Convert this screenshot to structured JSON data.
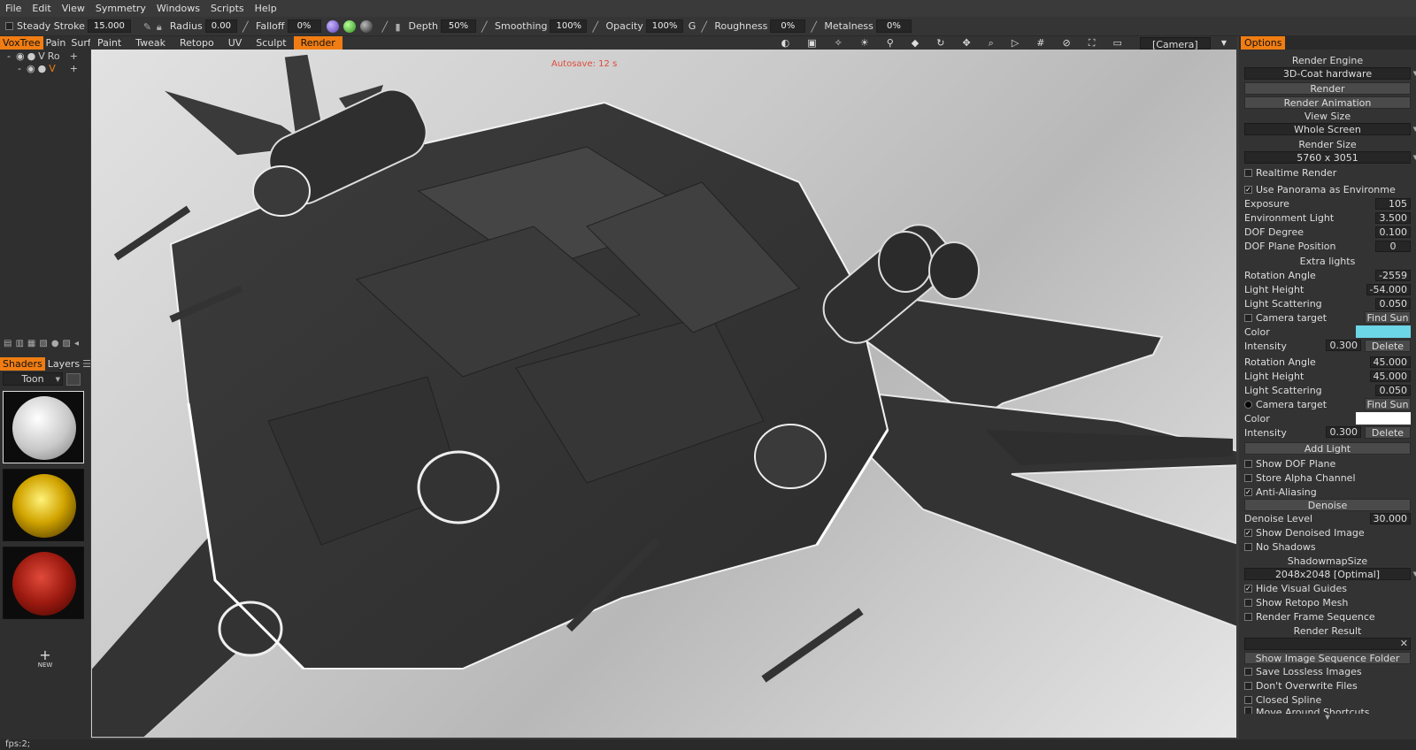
{
  "menu": [
    "File",
    "Edit",
    "View",
    "Symmetry",
    "Windows",
    "Scripts",
    "Help"
  ],
  "toolbar": {
    "steady_label": "Steady Stroke",
    "steady_value": "15.000",
    "radius_label": "Radius",
    "radius_value": "0.00",
    "falloff_label": "Falloff",
    "falloff_value": "0%",
    "depth_label": "Depth",
    "depth_value": "50%",
    "smoothing_label": "Smoothing",
    "smoothing_value": "100%",
    "opacity_label": "Opacity",
    "opacity_value": "100%",
    "g_label": "G",
    "roughness_label": "Roughness",
    "roughness_value": "0%",
    "metalness_label": "Metalness",
    "metalness_value": "0%",
    "camera_select": "[Camera]"
  },
  "left": {
    "tabs": [
      "VoxTree",
      "Pain",
      "Surf"
    ],
    "tree": [
      {
        "name": "V",
        "sub": "Ro"
      },
      {
        "name": "V",
        "sub": ""
      }
    ],
    "bottom_tabs": [
      "Shaders",
      "Layers"
    ],
    "shader_select": "Toon",
    "new_label": "NEW"
  },
  "mode_tabs": [
    "Paint",
    "Tweak",
    "Retopo",
    "UV",
    "Sculpt",
    "Render"
  ],
  "viewport": {
    "autosave": "Autosave:  12  s"
  },
  "options": {
    "title": "Options",
    "render_engine_label": "Render Engine",
    "render_engine": "3D-Coat hardware",
    "render_btn": "Render",
    "render_anim_btn": "Render Animation",
    "view_size_label": "View Size",
    "view_size": "Whole Screen",
    "render_size_label": "Render Size",
    "render_size": "5760  x  3051",
    "realtime": "Realtime  Render",
    "use_panorama": "Use  Panorama  as  Environme",
    "exposure_label": "Exposure",
    "exposure": "105",
    "env_light_label": "Environment  Light",
    "env_light": "3.500",
    "dof_degree_label": "DOF  Degree",
    "dof_degree": "0.100",
    "dof_plane_label": "DOF  Plane  Position",
    "dof_plane": "0",
    "extra_lights": "Extra  lights",
    "light1": {
      "rot_label": "Rotation  Angle",
      "rot": "-2559",
      "height_label": "Light  Height",
      "height": "-54.000",
      "scatter_label": "Light  Scattering",
      "scatter": "0.050",
      "camera_target": "Camera  target",
      "find_sun": "Find  Sun",
      "color_label": "Color",
      "color": "#6dd6e6",
      "intensity_label": "Intensity",
      "intensity": "0.300",
      "delete": "Delete"
    },
    "light2": {
      "rot_label": "Rotation  Angle",
      "rot": "45.000",
      "height_label": "Light  Height",
      "height": "45.000",
      "scatter_label": "Light  Scattering",
      "scatter": "0.050",
      "camera_target": "Camera  target",
      "find_sun": "Find  Sun",
      "color_label": "Color",
      "color": "#ffffff",
      "intensity_label": "Intensity",
      "intensity": "0.300",
      "delete": "Delete"
    },
    "add_light": "Add  Light",
    "show_dof": "Show  DOF  Plane",
    "store_alpha": "Store  Alpha  Channel",
    "anti_alias": "Anti-Aliasing",
    "denoise": "Denoise",
    "denoise_level_label": "Denoise  Level",
    "denoise_level": "30.000",
    "show_denoised": "Show  Denoised  Image",
    "no_shadows": "No  Shadows",
    "shadowmap_label": "ShadowmapSize",
    "shadowmap": "2048x2048  [Optimal]",
    "hide_guides": "Hide  Visual  Guides",
    "show_retopo": "Show  Retopo  Mesh",
    "render_seq": "Render  Frame  Sequence",
    "render_result": "Render  Result",
    "show_folder": "Show  Image  Sequence  Folder",
    "save_lossless": "Save  Lossless  Images",
    "dont_overwrite": "Don't  Overwrite  Files",
    "closed_spline": "Closed  Spline",
    "move_around": "Move  Around  Shortcuts"
  },
  "status": "fps:2;"
}
